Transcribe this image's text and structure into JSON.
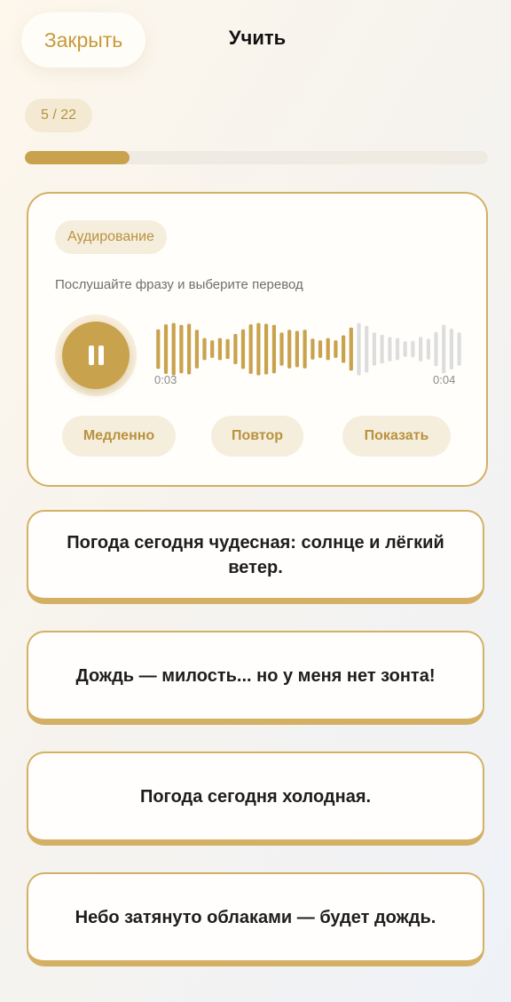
{
  "header": {
    "close_label": "Закрыть",
    "title": "Учить"
  },
  "progress": {
    "counter": "5 / 22",
    "current": 5,
    "total": 22,
    "fill_fraction": 0.227
  },
  "task": {
    "badge": "Аудирование",
    "instruction": "Послушайте фразу и выберите перевод",
    "state": "playing",
    "played_fraction": 0.66,
    "time_current": "0:03",
    "time_total": "0:04",
    "controls": {
      "slow": "Медленно",
      "repeat": "Повтор",
      "show": "Показать"
    }
  },
  "options": [
    "Погода сегодня чудесная: солнце и лёгкий ветер.",
    "Дождь — милость... но у меня нет зонта!",
    "Погода сегодня холодная.",
    "Небо затянуто облаками — будет дождь."
  ],
  "colors": {
    "accent": "#c9a24d",
    "accent_text": "#b8923f",
    "badge_bg": "#f6eedc",
    "wave_inactive": "#dddddd"
  },
  "icons": {
    "play_button": "pause-icon"
  }
}
